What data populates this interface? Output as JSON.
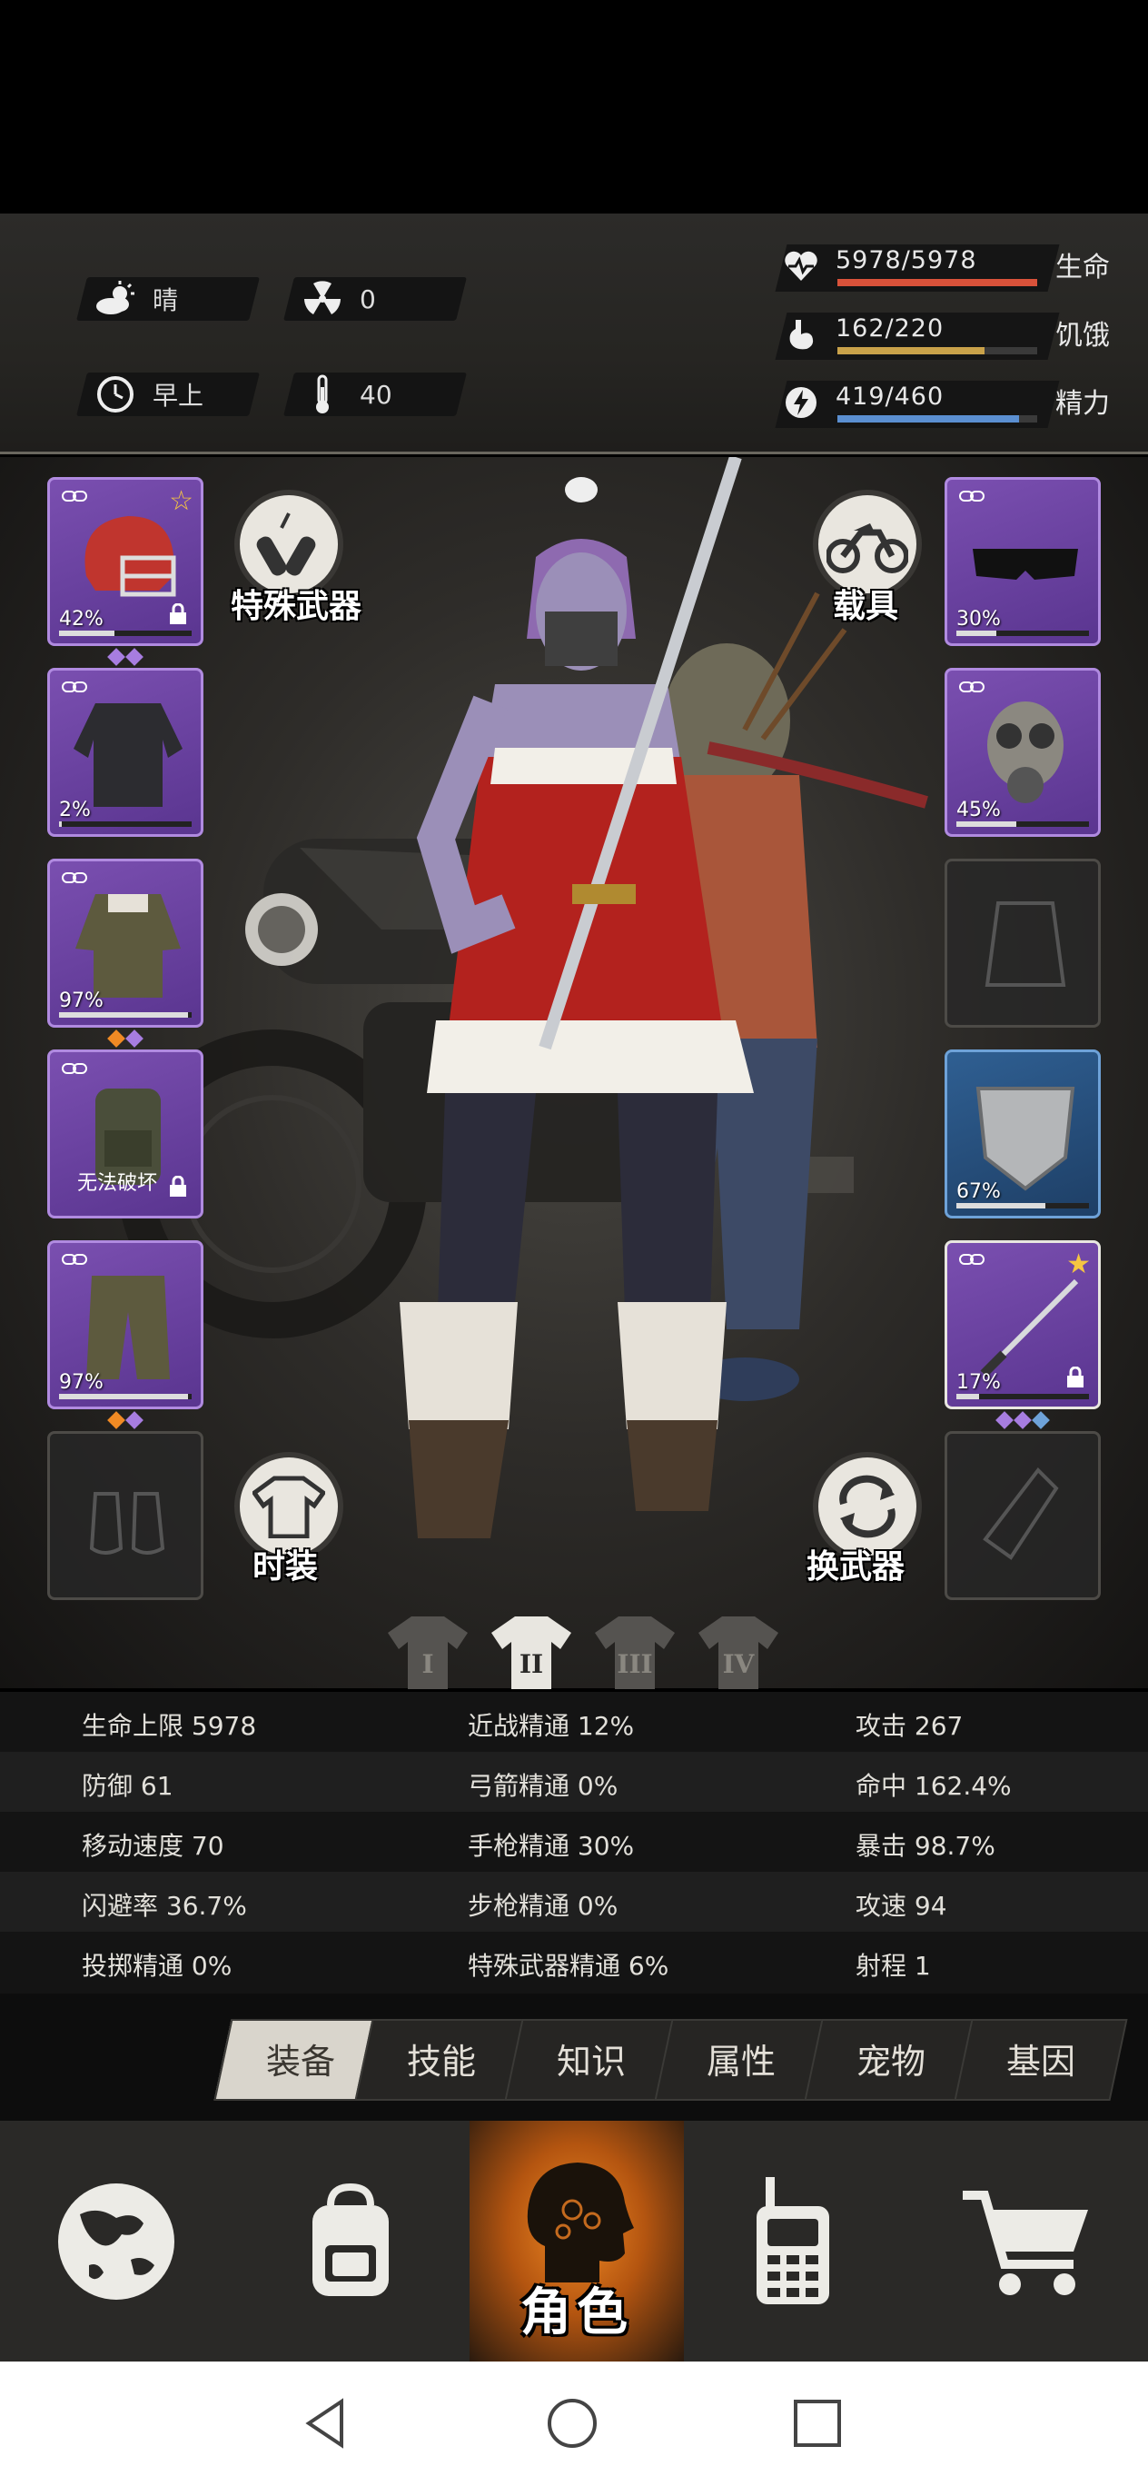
{
  "status": {
    "weather": {
      "icon": "sun-cloud-icon",
      "label": "晴"
    },
    "radiation": {
      "icon": "radiation-icon",
      "value": "0"
    },
    "time": {
      "icon": "clock-icon",
      "label": "早上"
    },
    "temperature": {
      "icon": "thermometer-icon",
      "value": "40"
    }
  },
  "vitals": [
    {
      "key": "health",
      "icon": "heart-icon",
      "value": "5978/5978",
      "label": "生命",
      "fraction": 1.0,
      "color": "#d9523a"
    },
    {
      "key": "hunger",
      "icon": "stomach-icon",
      "value": "162/220",
      "label": "饥饿",
      "fraction": 0.736,
      "color": "#c9a24a"
    },
    {
      "key": "energy",
      "icon": "energy-icon",
      "value": "419/460",
      "label": "精力",
      "fraction": 0.911,
      "color": "#5b8fd1"
    }
  ],
  "equipment_left": [
    {
      "name": "helmet",
      "quality": "purple",
      "durability": "42%",
      "durability_fraction": 0.42,
      "star": true,
      "locked": true,
      "gems": [
        "#a77de0",
        "#a77de0"
      ]
    },
    {
      "name": "shirt",
      "quality": "purple",
      "durability": "2%",
      "durability_fraction": 0.02,
      "star": false,
      "locked": false,
      "gems": []
    },
    {
      "name": "coat",
      "quality": "purple",
      "durability": "97%",
      "durability_fraction": 0.97,
      "star": false,
      "locked": false,
      "gems": [
        "#f08a24",
        "#a77de0"
      ]
    },
    {
      "name": "backpack",
      "quality": "purple",
      "durability": "无法破坏",
      "durability_fraction": 1.0,
      "star": false,
      "locked": true,
      "gems": []
    },
    {
      "name": "pants",
      "quality": "purple",
      "durability": "97%",
      "durability_fraction": 0.97,
      "star": false,
      "locked": false,
      "gems": [
        "#f08a24",
        "#a77de0"
      ]
    },
    {
      "name": "shoes",
      "quality": "empty"
    }
  ],
  "equipment_right": [
    {
      "name": "goggles",
      "quality": "purple",
      "durability": "30%",
      "durability_fraction": 0.3,
      "star": false,
      "locked": false,
      "gems": []
    },
    {
      "name": "gas-mask",
      "quality": "purple",
      "durability": "45%",
      "durability_fraction": 0.45,
      "star": false,
      "locked": false,
      "gems": []
    },
    {
      "name": "vest",
      "quality": "empty"
    },
    {
      "name": "shield",
      "quality": "blue",
      "durability": "67%",
      "durability_fraction": 0.67,
      "star": false,
      "locked": false,
      "gems": []
    },
    {
      "name": "katana",
      "quality": "purple",
      "durability": "17%",
      "durability_fraction": 0.17,
      "star": true,
      "locked": true,
      "gems": [
        "#a77de0",
        "#a77de0",
        "#6ea2d8"
      ]
    },
    {
      "name": "bottle",
      "quality": "empty"
    }
  ],
  "buttons": {
    "special_weapon": "特殊武器",
    "vehicle": "载具",
    "fashion": "时装",
    "swap_weapon": "换武器"
  },
  "outfit_sets": [
    "I",
    "II",
    "III",
    "IV"
  ],
  "outfit_active": 1,
  "stats": [
    [
      "生命上限 5978",
      "近战精通 12%",
      "攻击 267"
    ],
    [
      "防御 61",
      "弓箭精通 0%",
      "命中 162.4%"
    ],
    [
      "移动速度 70",
      "手枪精通 30%",
      "暴击 98.7%"
    ],
    [
      "闪避率 36.7%",
      "步枪精通 0%",
      "攻速 94"
    ],
    [
      "投掷精通 0%",
      "特殊武器精通 6%",
      "射程 1"
    ]
  ],
  "tabs": [
    "装备",
    "技能",
    "知识",
    "属性",
    "宠物",
    "基因"
  ],
  "active_tab": 0,
  "bottom_nav": [
    {
      "name": "world-map",
      "icon": "globe-icon",
      "label": ""
    },
    {
      "name": "inventory",
      "icon": "backpack-icon",
      "label": ""
    },
    {
      "name": "character",
      "icon": "head-icon",
      "label": "角色",
      "active": true
    },
    {
      "name": "radio",
      "icon": "walkie-talkie-icon",
      "label": ""
    },
    {
      "name": "shop",
      "icon": "cart-icon",
      "label": ""
    }
  ]
}
